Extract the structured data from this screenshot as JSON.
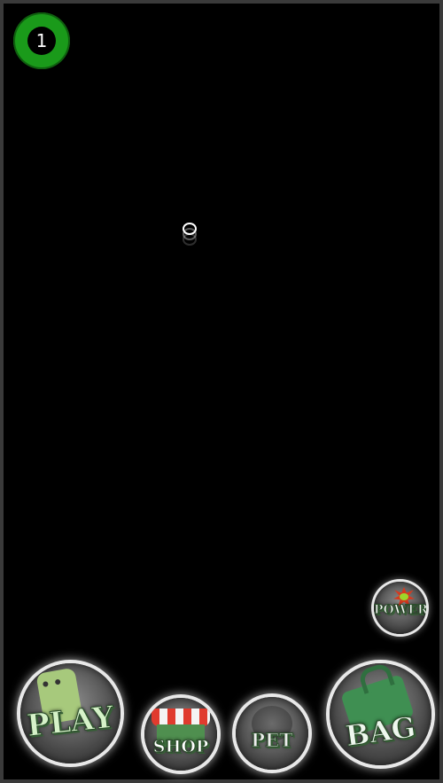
{
  "hud": {
    "level": "1",
    "level_color": "#1a9a1a"
  },
  "loader": {
    "icon": "loading-rings-icon"
  },
  "buttons": {
    "power": "POWER",
    "play": "PLAY",
    "shop": "SHOP",
    "pet": "PET",
    "bag": "BAG"
  }
}
